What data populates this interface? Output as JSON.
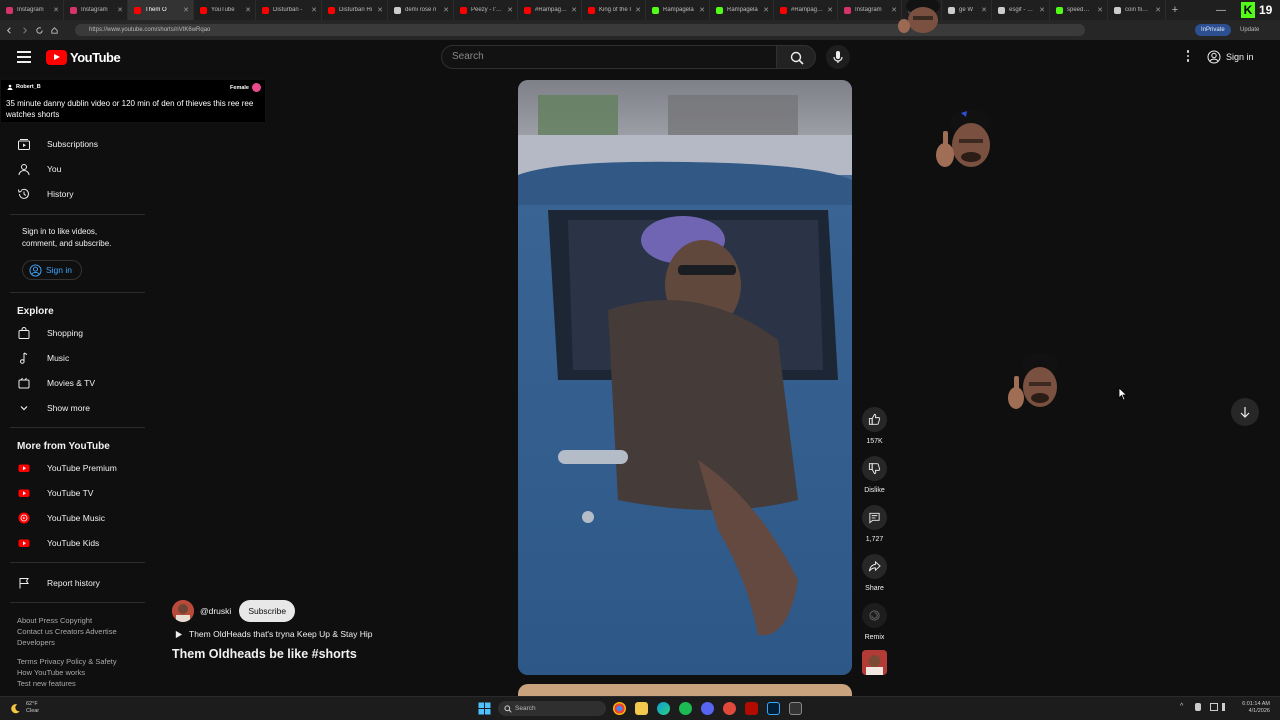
{
  "browser": {
    "tabs": [
      {
        "label": "Instagram",
        "color": "#d6336c"
      },
      {
        "label": "Instagram",
        "color": "#d6336c"
      },
      {
        "label": "Them O",
        "color": "#ff0000",
        "active": true
      },
      {
        "label": "YouTube",
        "color": "#ff0000"
      },
      {
        "label": "Disturban -",
        "color": "#ff0000"
      },
      {
        "label": "Disturban Hi",
        "color": "#ff0000"
      },
      {
        "label": "demi rose n",
        "color": "#cccccc"
      },
      {
        "label": "Peezy - I'm l",
        "color": "#ff0000"
      },
      {
        "label": "#Rampagela",
        "color": "#ff0000"
      },
      {
        "label": "King of the I",
        "color": "#ff0000"
      },
      {
        "label": "Rampagela",
        "color": "#53fc18"
      },
      {
        "label": "Rampagela",
        "color": "#53fc18"
      },
      {
        "label": "#Rampagela",
        "color": "#ff0000"
      },
      {
        "label": "Instagram",
        "color": "#d6336c"
      },
      {
        "label": "",
        "color": "#444444"
      },
      {
        "label": "ge W",
        "color": "#cccccc"
      },
      {
        "label": "esgif - Goog",
        "color": "#cccccc"
      },
      {
        "label": "speedWHAT",
        "color": "#53fc18"
      },
      {
        "label": "coin flip - G",
        "color": "#cccccc"
      }
    ],
    "new_tab": "+",
    "minimize": "—",
    "close": "✕",
    "kick_badge": "K",
    "kick_count": "19",
    "url": "https://www.youtube.com/shorts/nVtK6wRqao",
    "inprivate": "InPrivate",
    "update": "Update"
  },
  "header": {
    "logo_text": "YouTube",
    "search_placeholder": "Search",
    "sign_in": "Sign in"
  },
  "alert": {
    "username": "Robert_B",
    "gender": "Female",
    "message": "35 minute danny dublin video or 120 min of den of thieves this ree ree watches shorts"
  },
  "sidebar": {
    "items": [
      {
        "label": "Subscriptions",
        "icon": "subscriptions-icon"
      },
      {
        "label": "You",
        "icon": "you-icon"
      },
      {
        "label": "History",
        "icon": "history-icon"
      }
    ],
    "signin_note": "Sign in to like videos, comment, and subscribe.",
    "signin_button": "Sign in",
    "explore_heading": "Explore",
    "explore": [
      {
        "label": "Shopping",
        "icon": "shopping-icon"
      },
      {
        "label": "Music",
        "icon": "music-icon"
      },
      {
        "label": "Movies & TV",
        "icon": "movies-icon"
      },
      {
        "label": "Show more",
        "icon": "chevron-down-icon"
      }
    ],
    "more_heading": "More from YouTube",
    "more": [
      {
        "label": "YouTube Premium"
      },
      {
        "label": "YouTube TV"
      },
      {
        "label": "YouTube Music"
      },
      {
        "label": "YouTube Kids"
      }
    ],
    "report_history": "Report history",
    "footer_line1": "About  Press  Copyright",
    "footer_line2": "Contact us  Creators  Advertise",
    "footer_line3": "Developers",
    "footer_line4": "Terms  Privacy  Policy & Safety",
    "footer_line5": "How YouTube works",
    "footer_line6": "Test new features"
  },
  "video": {
    "channel": "@druski",
    "subscribe": "Subscribe",
    "sound": "Them OldHeads that's tryna Keep Up & Stay Hip",
    "title": "Them Oldheads be like #shorts"
  },
  "actions": {
    "likes": "157K",
    "dislike": "Dislike",
    "comments": "1,727",
    "share": "Share",
    "remix": "Remix"
  },
  "taskbar": {
    "temp": "62°F",
    "condition": "Clear",
    "search": "Search",
    "time": "6:01:14 AM",
    "date": "4/1/2026"
  },
  "colors": {
    "youtube_red": "#ff0000",
    "link_blue": "#3ea6ff",
    "background": "#0f0f0f"
  }
}
